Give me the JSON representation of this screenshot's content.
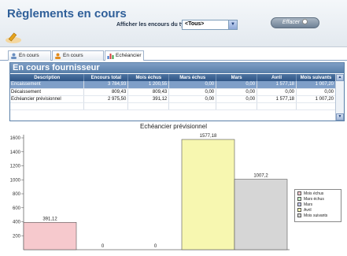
{
  "header": {
    "title": "Règlements en cours",
    "filter_label": "Afficher les encours du type",
    "filter_value": "<Tous>",
    "clear_label": "Effacer"
  },
  "tabs": [
    {
      "label": "En cours client"
    },
    {
      "label": "En cours fournisseur"
    },
    {
      "label": "Echéancier"
    }
  ],
  "panel": {
    "title": "En cours fournisseur",
    "columns": [
      "Description",
      "Encours total",
      "Mois échus",
      "Mars échus",
      "Mars",
      "Avril",
      "Mois suivants"
    ],
    "rows": [
      [
        "Encaissement",
        "3 784,93",
        "1 200,55",
        "0,00",
        "0,00",
        "1 577,18",
        "1 007,20"
      ],
      [
        "Décaissement",
        "809,43",
        "809,43",
        "0,00",
        "0,00",
        "0,00",
        "0,00"
      ],
      [
        "Echéancier prévisionnel",
        "2 975,50",
        "391,12",
        "0,00",
        "0,00",
        "1 577,18",
        "1 007,20"
      ]
    ]
  },
  "colors": {
    "accent": "#2f5f99",
    "header_bg": "#e3e9ef",
    "selected_row": "#7f9fc8"
  },
  "chart_data": {
    "type": "bar",
    "title": "Echéancier prévisionnel",
    "categories": [
      "Mois échus",
      "Mars échus",
      "Mars",
      "Avril",
      "Mois suivants"
    ],
    "values": [
      391.12,
      0,
      0,
      1577.18,
      1007.2
    ],
    "value_labels": [
      "391,12",
      "0",
      "0",
      "1577,18",
      "1007,2"
    ],
    "colors": [
      "#f6c9cd",
      "#c9f0c9",
      "#c5c9ee",
      "#f7f7b0",
      "#d6d6d6"
    ],
    "yticks": [
      "1600",
      "1400",
      "1200",
      "1000",
      "800",
      "600",
      "400",
      "200"
    ],
    "ylim": [
      0,
      1600
    ],
    "grid": false,
    "legend": "right"
  }
}
